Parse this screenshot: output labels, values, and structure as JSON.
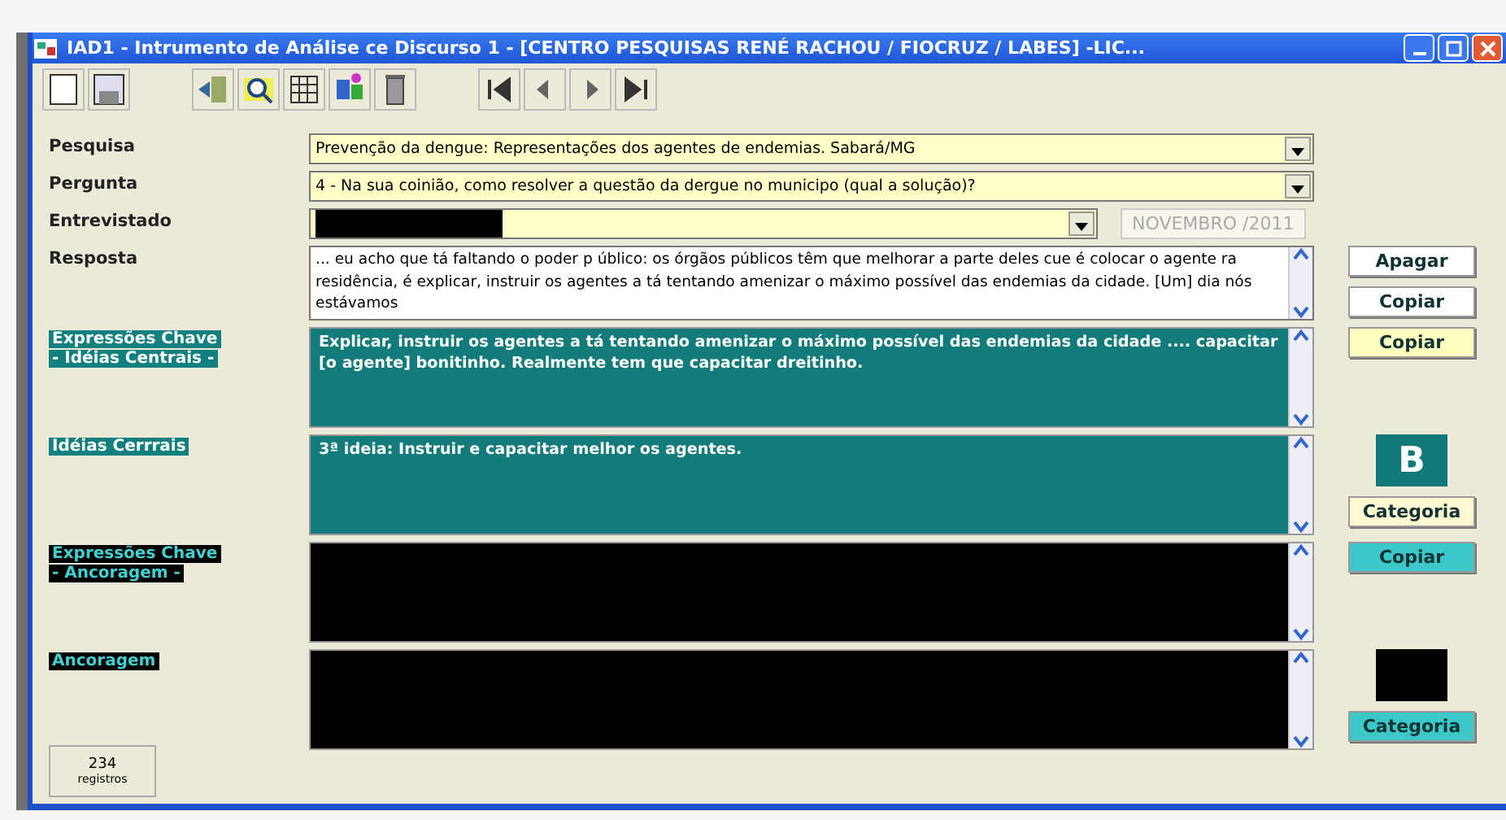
{
  "window": {
    "title": "IAD1 - Intrumento de Análise ce Discurso 1  - [CENTRO PESQUISAS RENÉ RACHOU / FIOCRUZ / LABES]  -LIC..."
  },
  "fields": [
    {
      "label": "Pesquisa",
      "value": "Prevenção da dengue: Representações dos agentes de endemias. Sabará/MG"
    },
    {
      "label": "Pergunta",
      "value": "4 - Na sua coinião, como resolver a questão da dergue no municipo (qual a solução)?"
    }
  ],
  "interviewee": {
    "label": "Entrevistado",
    "date": "NOVEMBRO /2011"
  },
  "answer": {
    "label": "Resposta",
    "text": "... eu acho que tá faltando o poder p úblico: os órgãos públicos têm que melhorar a parte deles cue é colocar o agente ra residência, é explicar, instruir os agentes a tá tentando amenizar o máximo possível das endemias da cidade. [Um] dia nós estávamos",
    "buttons": [
      "Apagar",
      "Copiar"
    ]
  },
  "sections": [
    {
      "kind": "teal",
      "label": [
        "Expressões Chave",
        "- Idéias Centrais -"
      ],
      "text": "Explicar, instruir os agentes a tá tentando amenizar o máximo possível das endemias da cidade .... capacitar [o agente] bonitinho. Realmente tem que capacitar dreitinho.",
      "actions": [
        {
          "kind": "button",
          "label": "Copiar",
          "color": "#ffffc0"
        }
      ]
    },
    {
      "kind": "teal",
      "label": [
        "Idéias Cerrrais"
      ],
      "text": "3ª ideia: Instruir e capacitar melhor os agentes.",
      "actions": [
        {
          "kind": "category",
          "text": "B",
          "color": "#117a78"
        },
        {
          "kind": "button",
          "label": "Categoria",
          "color": "#fff8d0"
        }
      ]
    },
    {
      "kind": "dark",
      "label": [
        "Expressões Chave",
        "- Ancoragem -"
      ],
      "actions": [
        {
          "kind": "button",
          "label": "Copiar",
          "color": "#3cc8c8"
        }
      ]
    },
    {
      "kind": "dark",
      "label": [
        "Ancoragem"
      ],
      "actions": [
        {
          "kind": "category",
          "color": "#000000"
        },
        {
          "kind": "button",
          "label": "Categoria",
          "color": "#3cc8c8"
        }
      ]
    }
  ],
  "records": {
    "count": "234",
    "label": "registros"
  }
}
